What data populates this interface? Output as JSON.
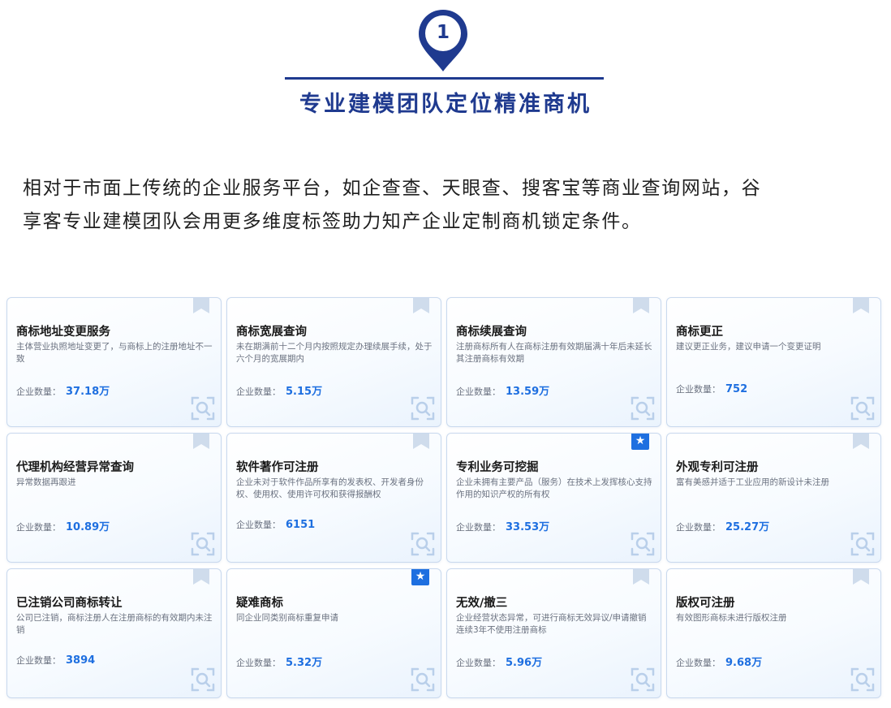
{
  "header": {
    "step_number": "1",
    "title": "专业建模团队定位精准商机",
    "intro_lines": [
      "相对于市面上传统的企业服务平台，如企查查、天眼查、搜客宝等商业查询网站，谷",
      "享客专业建模团队会用更多维度标签助力知产企业定制商机锁定条件。"
    ]
  },
  "colors": {
    "brand_navy": "#1f3a8f",
    "accent_blue": "#1e6fe0",
    "card_border": "#c9d9ee"
  },
  "count_label": "企业数量：",
  "cards": [
    {
      "title": "商标地址变更服务",
      "desc": "主体营业执照地址变更了，与商标上的注册地址不一致",
      "count": "37.18万",
      "badge": "bookmark"
    },
    {
      "title": "商标宽展查询",
      "desc": "未在期满前十二个月内按照规定办理续展手续，处于六个月的宽展期内",
      "count": "5.15万",
      "badge": "bookmark"
    },
    {
      "title": "商标续展查询",
      "desc": "注册商标所有人在商标注册有效期届满十年后未延长其注册商标有效期",
      "count": "13.59万",
      "badge": "bookmark"
    },
    {
      "title": "商标更正",
      "desc": "建议更正业务，建议申请一个变更证明",
      "count": "752",
      "badge": "bookmark"
    },
    {
      "title": "代理机构经营异常查询",
      "desc": "异常数据再跟进",
      "count": "10.89万",
      "badge": "bookmark"
    },
    {
      "title": "软件著作可注册",
      "desc": "企业未对于软件作品所享有的发表权、开发者身份权、使用权、使用许可权和获得报酬权",
      "count": "6151",
      "badge": "bookmark"
    },
    {
      "title": "专利业务可挖掘",
      "desc": "企业未拥有主要产品（服务）在技术上发挥核心支持作用的知识产权的所有权",
      "count": "33.53万",
      "badge": "star"
    },
    {
      "title": "外观专利可注册",
      "desc": "富有美感并适于工业应用的新设计未注册",
      "count": "25.27万",
      "badge": "bookmark"
    },
    {
      "title": "已注销公司商标转让",
      "desc": "公司已注销，商标注册人在注册商标的有效期内未注销",
      "count": "3894",
      "badge": "bookmark"
    },
    {
      "title": "疑难商标",
      "desc": "同企业同类别商标重复申请",
      "count": "5.32万",
      "badge": "star"
    },
    {
      "title": "无效/撤三",
      "desc": "企业经营状态异常，可进行商标无效异议/申请撤销连续3年不使用注册商标",
      "count": "5.96万",
      "badge": "bookmark"
    },
    {
      "title": "版权可注册",
      "desc": "有效图形商标未进行版权注册",
      "count": "9.68万",
      "badge": "bookmark"
    }
  ]
}
